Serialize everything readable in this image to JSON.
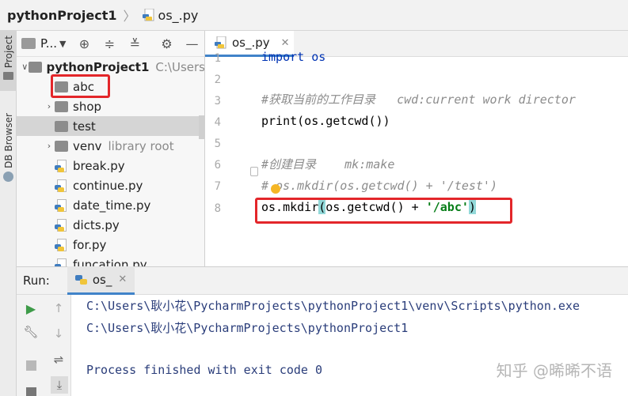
{
  "breadcrumb": {
    "project": "pythonProject1",
    "file": "os_.py"
  },
  "left_strip": {
    "project_tab": "Project",
    "db_tab": "DB Browser"
  },
  "project_panel": {
    "dropdown_label": "P...",
    "tree": [
      {
        "label": "pythonProject1",
        "suffix": "C:\\Users",
        "type": "folder-root",
        "expanded": true
      },
      {
        "label": "abc",
        "type": "folder"
      },
      {
        "label": "shop",
        "type": "folder",
        "collapsed": true
      },
      {
        "label": "test",
        "type": "folder",
        "selected": true
      },
      {
        "label": "venv",
        "suffix": "library root",
        "type": "folder",
        "collapsed": true
      },
      {
        "label": "break.py",
        "type": "py"
      },
      {
        "label": "continue.py",
        "type": "py"
      },
      {
        "label": "date_time.py",
        "type": "py"
      },
      {
        "label": "dicts.py",
        "type": "py"
      },
      {
        "label": "for.py",
        "type": "py"
      },
      {
        "label": "funcation.py",
        "type": "py"
      }
    ]
  },
  "editor": {
    "tab_label": "os_.py",
    "line_numbers": [
      "1",
      "2",
      "3",
      "4",
      "5",
      "6",
      "7",
      "8"
    ],
    "lines": {
      "l1": "import os",
      "l3": "#获取当前的工作目录   cwd:current work director",
      "l4": "print(os.getcwd())",
      "l6": "#创建目录    mk:make",
      "l7a": "#",
      "l7b": "os.mkdir(os.getcwd() + '/test')",
      "l8_a": "os.mkdir",
      "l8_b": "(",
      "l8_c": "os.getcwd() + ",
      "l8_d": "'/abc'",
      "l8_e": ")"
    }
  },
  "run": {
    "title": "Run:",
    "tab_label": "os_",
    "console": [
      "C:\\Users\\耿小花\\PycharmProjects\\pythonProject1\\venv\\Scripts\\python.exe",
      "C:\\Users\\耿小花\\PycharmProjects\\pythonProject1",
      "",
      "Process finished with exit code 0"
    ]
  },
  "watermark": "知乎 @晞晞不语",
  "colors": {
    "highlight_box": "#e3262a",
    "accent": "#4083c9",
    "console_text": "#2a3d7a",
    "run_green": "#3e9b49"
  }
}
